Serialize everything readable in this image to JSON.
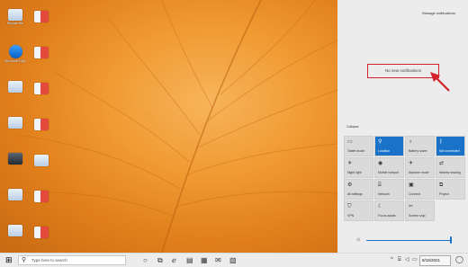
{
  "desktop": {
    "icons_left": [
      {
        "label": "Recycle Bin",
        "glyph": "recycle-bin-icon",
        "style": ""
      },
      {
        "label": "Microsoft Edge",
        "glyph": "edge-icon",
        "style": "edge"
      },
      {
        "label": "",
        "glyph": "file-icon",
        "style": ""
      },
      {
        "label": "",
        "glyph": "file-icon",
        "style": ""
      },
      {
        "label": "",
        "glyph": "file-icon",
        "style": "dark"
      },
      {
        "label": "",
        "glyph": "file-icon",
        "style": ""
      },
      {
        "label": "",
        "glyph": "file-icon",
        "style": ""
      }
    ],
    "icons_right": [
      {
        "label": "",
        "glyph": "file-icon",
        "style": "flag"
      },
      {
        "label": "",
        "glyph": "file-icon",
        "style": "flag"
      },
      {
        "label": "",
        "glyph": "file-icon",
        "style": "flag"
      },
      {
        "label": "",
        "glyph": "file-icon",
        "style": "flag"
      },
      {
        "label": "",
        "glyph": "file-icon",
        "style": ""
      },
      {
        "label": "",
        "glyph": "file-icon",
        "style": "flag"
      },
      {
        "label": "",
        "glyph": "file-icon",
        "style": "flag"
      }
    ]
  },
  "action_center": {
    "manage_label": "Manage notifications",
    "no_new_label": "No new notifications",
    "collapse_label": "Collapse",
    "tiles": [
      {
        "label": "Tablet mode",
        "icon": "tablet-mode-icon",
        "glyph": "▭",
        "on": false
      },
      {
        "label": "Location",
        "icon": "location-icon",
        "glyph": "⚲",
        "on": true
      },
      {
        "label": "Battery saver",
        "icon": "battery-saver-icon",
        "glyph": "♁",
        "on": false
      },
      {
        "label": "Not connected",
        "icon": "bluetooth-icon",
        "glyph": "ᛒ",
        "on": true
      },
      {
        "label": "Night light",
        "icon": "night-light-icon",
        "glyph": "☀",
        "on": false
      },
      {
        "label": "Mobile hotspot",
        "icon": "mobile-hotspot-icon",
        "glyph": "◉",
        "on": false
      },
      {
        "label": "Airplane mode",
        "icon": "airplane-mode-icon",
        "glyph": "✈",
        "on": false
      },
      {
        "label": "Nearby sharing",
        "icon": "nearby-sharing-icon",
        "glyph": "⇄",
        "on": false
      },
      {
        "label": "All settings",
        "icon": "settings-icon",
        "glyph": "⚙",
        "on": false
      },
      {
        "label": "Network",
        "icon": "network-icon",
        "glyph": "⌸",
        "on": false
      },
      {
        "label": "Connect",
        "icon": "connect-icon",
        "glyph": "▣",
        "on": false
      },
      {
        "label": "Project",
        "icon": "project-icon",
        "glyph": "⧉",
        "on": false
      },
      {
        "label": "VPN",
        "icon": "vpn-icon",
        "glyph": "⛉",
        "on": false
      },
      {
        "label": "Focus assist",
        "icon": "focus-assist-icon",
        "glyph": "☾",
        "on": false
      },
      {
        "label": "Screen snip",
        "icon": "screen-snip-icon",
        "glyph": "✂",
        "on": false
      }
    ],
    "brightness": {
      "icon": "brightness-icon",
      "level": 0.9
    }
  },
  "taskbar": {
    "search_placeholder": "Type here to search",
    "pinned": [
      {
        "name": "cortana-icon",
        "glyph": "○"
      },
      {
        "name": "task-view-icon",
        "glyph": "⧉"
      },
      {
        "name": "edge-icon",
        "glyph": "ℯ"
      },
      {
        "name": "file-explorer-icon",
        "glyph": "▤"
      },
      {
        "name": "store-icon",
        "glyph": "▦"
      },
      {
        "name": "mail-icon",
        "glyph": "✉"
      },
      {
        "name": "photos-icon",
        "glyph": "▧"
      }
    ],
    "tray": [
      {
        "name": "show-hidden-icon",
        "glyph": "^"
      },
      {
        "name": "network-icon",
        "glyph": "⌸"
      },
      {
        "name": "volume-icon",
        "glyph": "◁"
      },
      {
        "name": "battery-icon",
        "glyph": "▭"
      }
    ],
    "date": "8/15/2021",
    "notification_icon": "◯"
  }
}
